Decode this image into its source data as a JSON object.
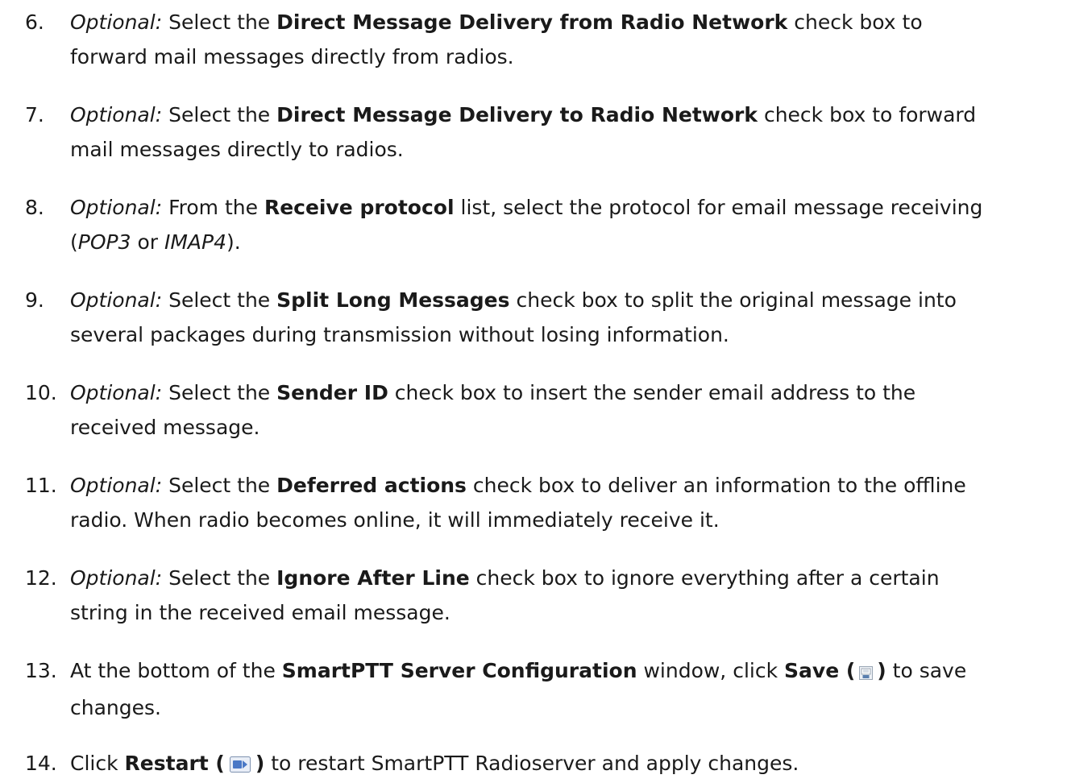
{
  "steps": [
    {
      "number": "6.",
      "optional": "Optional:",
      "t1": " Select the ",
      "b1": "Direct Message Delivery from Radio Network",
      "t2": " check box to",
      "line2": "forward mail messages directly from radios."
    },
    {
      "number": "7.",
      "optional": "Optional:",
      "t1": " Select the ",
      "b1": "Direct Message Delivery to Radio Network",
      "t2": " check box to forward",
      "line2": "mail messages directly to radios."
    },
    {
      "number": "8.",
      "optional": "Optional:",
      "t1": " From the ",
      "b1": "Receive protocol",
      "t2": " list, select the protocol for email message receiving",
      "paren_open": "(",
      "i1": "POP3",
      "or": " or ",
      "i2": "IMAP4",
      "paren_close": ")."
    },
    {
      "number": "9.",
      "optional": "Optional:",
      "t1": " Select the ",
      "b1": "Split Long Messages",
      "t2": " check box to split the original message into",
      "line2": "several packages during transmission without losing information."
    },
    {
      "number": "10.",
      "optional": "Optional:",
      "t1": " Select the ",
      "b1": "Sender ID",
      "t2": " check box to insert the sender email address to the",
      "line2": "received message."
    },
    {
      "number": "11.",
      "optional": "Optional:",
      "t1": " Select the ",
      "b1": "Deferred actions",
      "t2": " check box to deliver an information to the offline",
      "line2": "radio. When radio becomes online, it will immediately receive it."
    },
    {
      "number": "12.",
      "optional": "Optional:",
      "t1": " Select the ",
      "b1": "Ignore After Line",
      "t2": " check box to ignore everything after a certain",
      "line2": "string in the received email message."
    },
    {
      "number": "13.",
      "t1": "At the bottom of the ",
      "b1": "SmartPTT Server Configuration",
      "t2": " window, click ",
      "b2": "Save (",
      "b3": ")",
      "t3": " to save",
      "line2": "changes.",
      "icon": "save-icon"
    },
    {
      "number": "14.",
      "t1": "Click ",
      "b1": "Restart (",
      "b2": ")",
      "t2": " to restart SmartPTT Radioserver and apply changes.",
      "icon": "restart-icon"
    }
  ]
}
